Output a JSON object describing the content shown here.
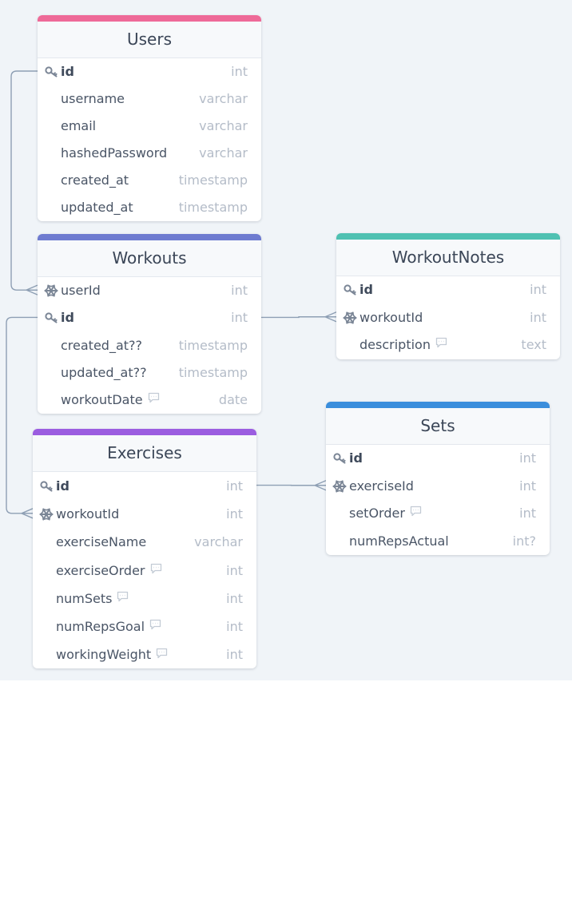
{
  "tables": [
    {
      "key": "users",
      "name": "Users",
      "header_color": "#ee6a98",
      "columns": [
        {
          "name": "id",
          "type": "int",
          "key": "pk"
        },
        {
          "name": "username",
          "type": "varchar"
        },
        {
          "name": "email",
          "type": "varchar"
        },
        {
          "name": "hashedPassword",
          "type": "varchar"
        },
        {
          "name": "created_at",
          "type": "timestamp"
        },
        {
          "name": "updated_at",
          "type": "timestamp"
        }
      ]
    },
    {
      "key": "workouts",
      "name": "Workouts",
      "header_color": "#6e7bd0",
      "columns": [
        {
          "name": "userId",
          "type": "int",
          "key": "fk"
        },
        {
          "name": "id",
          "type": "int",
          "key": "pk"
        },
        {
          "name": "created_at??",
          "type": "timestamp"
        },
        {
          "name": "updated_at??",
          "type": "timestamp"
        },
        {
          "name": "workoutDate",
          "type": "date",
          "note": true
        }
      ]
    },
    {
      "key": "workoutnotes",
      "name": "WorkoutNotes",
      "header_color": "#4fc1b2",
      "columns": [
        {
          "name": "id",
          "type": "int",
          "key": "pk"
        },
        {
          "name": "workoutId",
          "type": "int",
          "key": "fk"
        },
        {
          "name": "description",
          "type": "text",
          "note": true
        }
      ]
    },
    {
      "key": "exercises",
      "name": "Exercises",
      "header_color": "#9b5de0",
      "columns": [
        {
          "name": "id",
          "type": "int",
          "key": "pk"
        },
        {
          "name": "workoutId",
          "type": "int",
          "key": "fk"
        },
        {
          "name": "exerciseName",
          "type": "varchar"
        },
        {
          "name": "exerciseOrder",
          "type": "int",
          "note": true
        },
        {
          "name": "numSets",
          "type": "int",
          "note": true
        },
        {
          "name": "numRepsGoal",
          "type": "int",
          "note": true
        },
        {
          "name": "workingWeight",
          "type": "int",
          "note": true
        }
      ]
    },
    {
      "key": "sets",
      "name": "Sets",
      "header_color": "#3b8edc",
      "columns": [
        {
          "name": "id",
          "type": "int",
          "key": "pk"
        },
        {
          "name": "exerciseId",
          "type": "int",
          "key": "fk"
        },
        {
          "name": "setOrder",
          "type": "int",
          "note": true
        },
        {
          "name": "numRepsActual",
          "type": "int?"
        }
      ]
    }
  ],
  "relationships": [
    {
      "from": "Users.id",
      "to": "Workouts.userId"
    },
    {
      "from": "Workouts.id",
      "to": "WorkoutNotes.workoutId"
    },
    {
      "from": "Workouts.id",
      "to": "Exercises.workoutId"
    },
    {
      "from": "Exercises.id",
      "to": "Sets.exerciseId"
    }
  ],
  "icons": {
    "primary_key": "key-icon",
    "foreign_key": "snowflake-icon",
    "note": "comment-icon"
  },
  "line_color": "#8e9fb4"
}
